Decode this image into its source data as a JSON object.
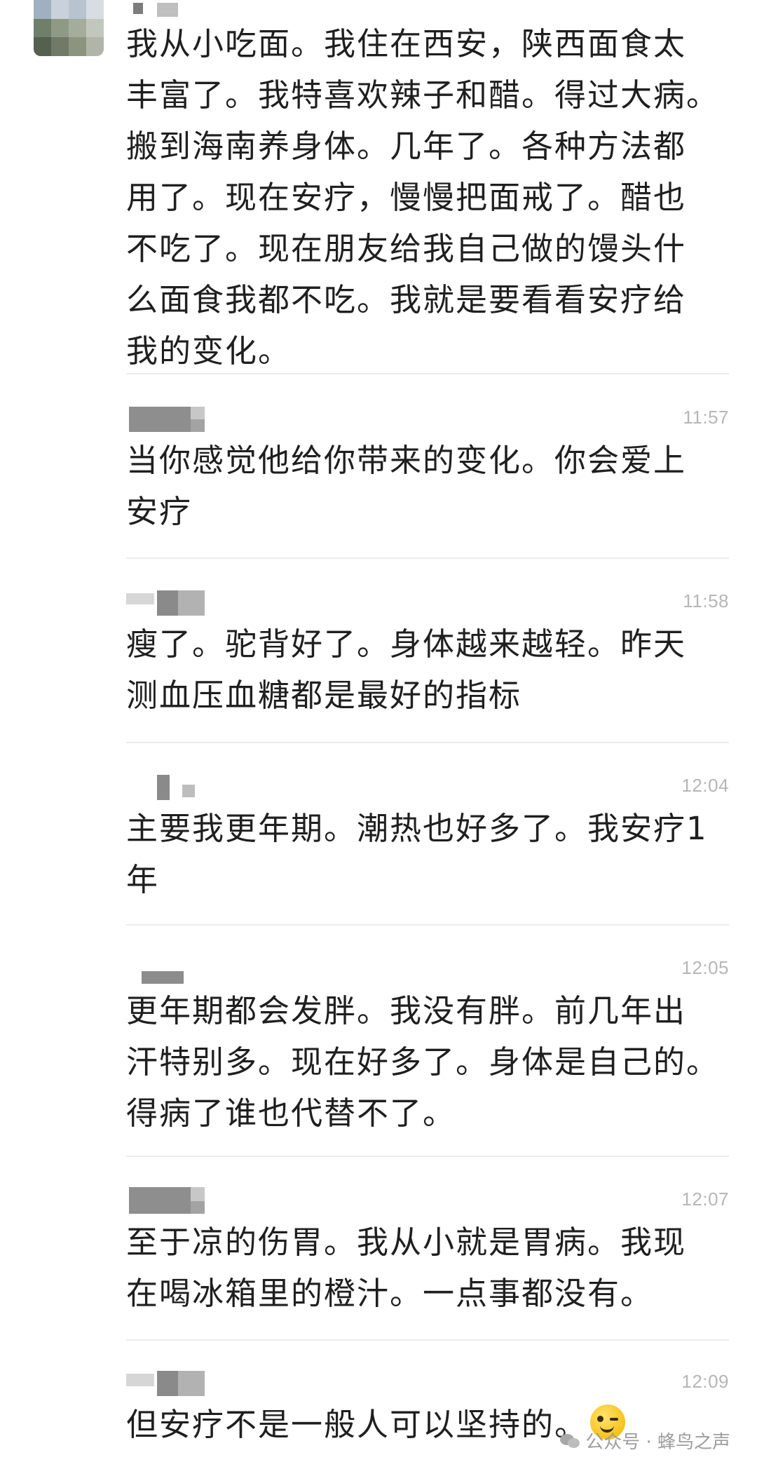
{
  "messages": [
    {
      "time": "",
      "lines": [
        "我从小吃面。我住在西安，陕西面食太",
        "丰富了。我特喜欢辣子和醋。得过大病。",
        "搬到海南养身体。几年了。各种方法都",
        "用了。现在安疗，慢慢把面戒了。醋也",
        "不吃了。现在朋友给我自己做的馒头什",
        "么面食我都不吃。我就是要看看安疗给",
        "我的变化。"
      ]
    },
    {
      "time": "11:57",
      "lines": [
        "当你感觉他给你带来的变化。你会爱上",
        "安疗"
      ]
    },
    {
      "time": "11:58",
      "lines": [
        "瘦了。驼背好了。身体越来越轻。昨天",
        "测血压血糖都是最好的指标"
      ]
    },
    {
      "time": "12:04",
      "lines": [
        "主要我更年期。潮热也好多了。我安疗1",
        "年"
      ]
    },
    {
      "time": "12:05",
      "lines": [
        "更年期都会发胖。我没有胖。前几年出",
        "汗特别多。现在好多了。身体是自己的。",
        "得病了谁也代替不了。"
      ]
    },
    {
      "time": "12:07",
      "lines": [
        "至于凉的伤胃。我从小就是胃病。我现",
        "在喝冰箱里的橙汁。一点事都没有。"
      ]
    },
    {
      "time": "12:09",
      "lines": [
        "但安疗不是一般人可以坚持的。"
      ]
    }
  ],
  "watermark": {
    "text": "公众号 · 蜂鸟之声",
    "icon": "wechat-icon"
  },
  "colors": {
    "text": "#1f1f1f",
    "time": "#b6b6b6",
    "divider": "#ececec",
    "blur": "#9a9a9a"
  }
}
